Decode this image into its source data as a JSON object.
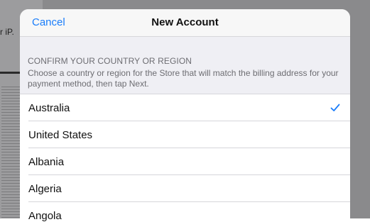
{
  "background": {
    "partial_text": "r iP."
  },
  "navbar": {
    "cancel_label": "Cancel",
    "title": "New Account"
  },
  "section": {
    "heading": "CONFIRM YOUR COUNTRY OR REGION",
    "description": "Choose a country or region for the Store that will match the billing address for your payment method, then tap Next."
  },
  "countries": [
    {
      "label": "Australia",
      "selected": true
    },
    {
      "label": "United States",
      "selected": false
    },
    {
      "label": "Albania",
      "selected": false
    },
    {
      "label": "Algeria",
      "selected": false
    },
    {
      "label": "Angola",
      "selected": false
    }
  ],
  "colors": {
    "accent": "#1a7dfa",
    "sheet_background": "#efeff4",
    "backdrop": "#8a8a8c"
  },
  "icons": {
    "selected_marker": "checkmark-icon"
  }
}
